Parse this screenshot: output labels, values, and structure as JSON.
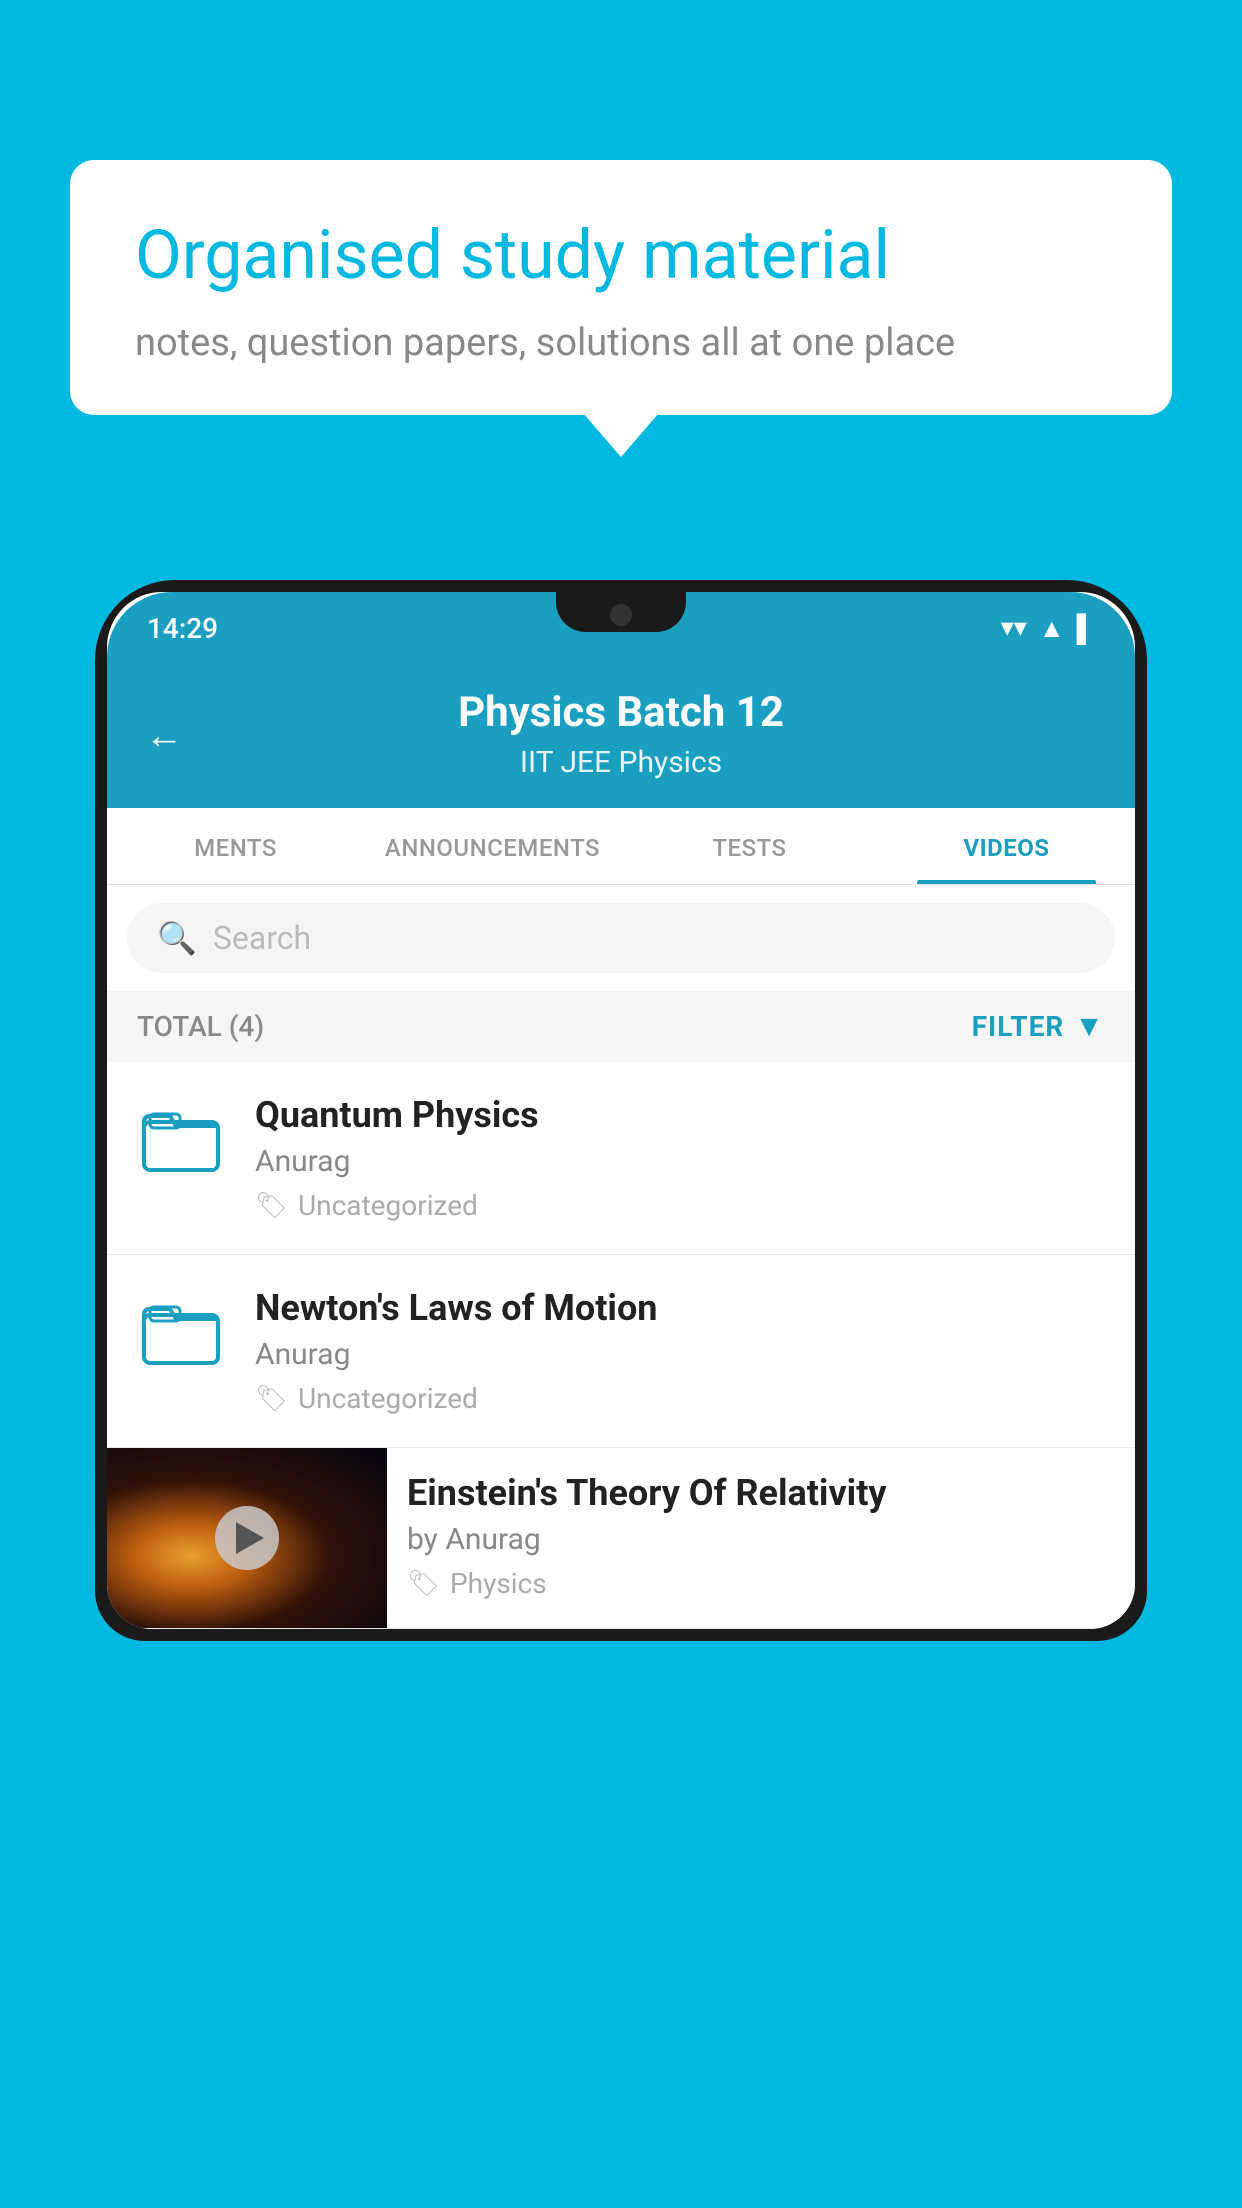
{
  "background_color": "#00b8e0",
  "bubble": {
    "title": "Organised study material",
    "subtitle": "notes, question papers, solutions all at one place"
  },
  "status_bar": {
    "time": "14:29"
  },
  "header": {
    "title": "Physics Batch 12",
    "tags": "IIT JEE   Physics",
    "back_label": "←"
  },
  "tabs": [
    {
      "label": "MENTS",
      "active": false
    },
    {
      "label": "ANNOUNCEMENTS",
      "active": false
    },
    {
      "label": "TESTS",
      "active": false
    },
    {
      "label": "VIDEOS",
      "active": true
    }
  ],
  "search": {
    "placeholder": "Search"
  },
  "filter_row": {
    "total": "TOTAL (4)",
    "filter_label": "FILTER"
  },
  "list_items": [
    {
      "title": "Quantum Physics",
      "author": "Anurag",
      "tag": "Uncategorized",
      "has_thumb": false
    },
    {
      "title": "Newton's Laws of Motion",
      "author": "Anurag",
      "tag": "Uncategorized",
      "has_thumb": false
    },
    {
      "title": "Einstein's Theory Of Relativity",
      "author": "by Anurag",
      "tag": "Physics",
      "has_thumb": true
    }
  ]
}
